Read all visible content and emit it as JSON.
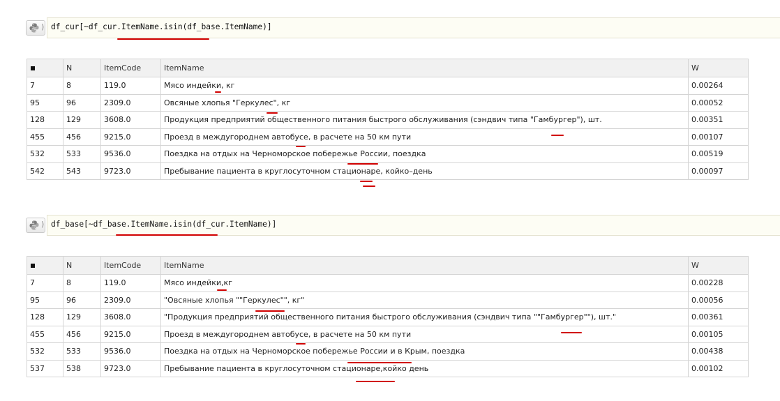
{
  "cells": [
    {
      "code": "df_cur[~df_cur.ItemName.isin(df_base.ItemName)]",
      "columns": [
        "N",
        "ItemCode",
        "ItemName",
        "W"
      ],
      "rows": [
        {
          "index": "7",
          "N": "8",
          "ItemCode": "119.0",
          "ItemName": "Мясо индейки, кг",
          "W": "0.00264"
        },
        {
          "index": "95",
          "N": "96",
          "ItemCode": "2309.0",
          "ItemName": "Овсяные хлопья \"Геркулес\", кг",
          "W": "0.00052"
        },
        {
          "index": "128",
          "N": "129",
          "ItemCode": "3608.0",
          "ItemName": "Продукция предприятий общественного питания быстрого обслуживания (сэндвич типа \"Гамбургер\"), шт.",
          "W": "0.00351"
        },
        {
          "index": "455",
          "N": "456",
          "ItemCode": "9215.0",
          "ItemName": "Проезд в междугороднем автобусе, в расчете на 50 км пути",
          "W": "0.00107"
        },
        {
          "index": "532",
          "N": "533",
          "ItemCode": "9536.0",
          "ItemName": "Поездка на отдых на Черноморское побережье России, поездка",
          "W": "0.00519"
        },
        {
          "index": "542",
          "N": "543",
          "ItemCode": "9723.0",
          "ItemName": "Пребывание пациента в круглосуточном стационаре, койко–день",
          "W": "0.00097"
        }
      ]
    },
    {
      "code": "df_base[~df_base.ItemName.isin(df_cur.ItemName)]",
      "columns": [
        "N",
        "ItemCode",
        "ItemName",
        "W"
      ],
      "rows": [
        {
          "index": "7",
          "N": "8",
          "ItemCode": "119.0",
          "ItemName": "Мясо индейки,кг",
          "W": "0.00228"
        },
        {
          "index": "95",
          "N": "96",
          "ItemCode": "2309.0",
          "ItemName": "\"Овсяные хлопья \"\"Геркулес\"\", кг\"",
          "W": "0.00056"
        },
        {
          "index": "128",
          "N": "129",
          "ItemCode": "3608.0",
          "ItemName": "\"Продукция предприятий общественного питания быстрого обслуживания (сэндвич типа \"\"Гамбургер\"\"), шт.\"",
          "W": "0.00361"
        },
        {
          "index": "455",
          "N": "456",
          "ItemCode": "9215.0",
          "ItemName": "Проезд в междугороднем автобусе, в расчете на 50 км пути",
          "W": "0.00105"
        },
        {
          "index": "532",
          "N": "533",
          "ItemCode": "9536.0",
          "ItemName": "Поездка на отдых на Черноморское побережье России и в Крым, поездка",
          "W": "0.00438"
        },
        {
          "index": "537",
          "N": "538",
          "ItemCode": "9723.0",
          "ItemName": "Пребывание пациента в круглосуточном стационаре,койко день",
          "W": "0.00102"
        }
      ]
    }
  ],
  "colors": {
    "code_bg": "#fdfdf4",
    "header_bg": "#f1f1f1",
    "border": "#d4d4d4",
    "annotation": "#d10000"
  },
  "icons": {
    "run_button": "python-logo-icon"
  }
}
